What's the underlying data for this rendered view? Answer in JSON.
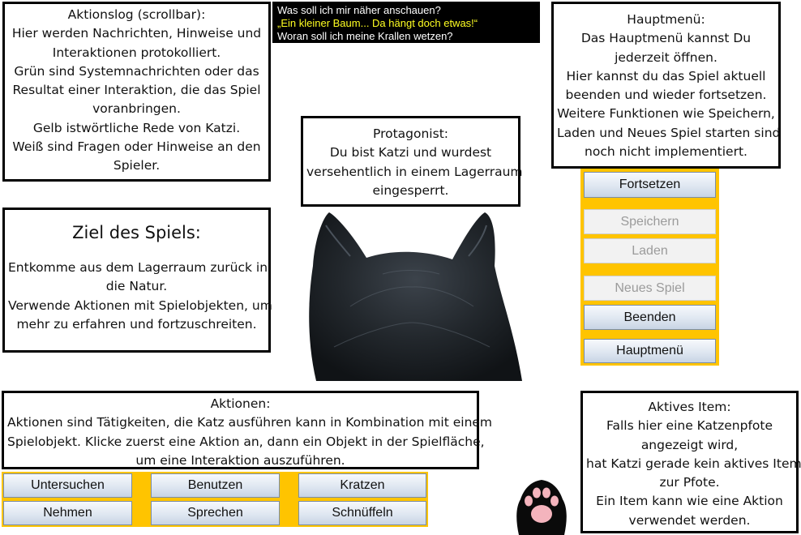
{
  "log": {
    "lines": [
      {
        "text": "Was soll ich mir näher anschauen?",
        "color": "#ffffff"
      },
      {
        "text": "„Ein kleiner Baum... Da hängt doch etwas!“",
        "color": "#ffff22"
      },
      {
        "text": "Woran soll ich meine Krallen wetzen?",
        "color": "#ffffff"
      }
    ]
  },
  "info_log": {
    "lines": [
      "Aktionslog (scrollbar):",
      "Hier werden Nachrichten, Hinweise und",
      "Interaktionen protokolliert.",
      "Grün sind Systemnachrichten oder das",
      "Resultat einer Interaktion, die das Spiel",
      "voranbringen.",
      "Gelb istwörtliche Rede von Katzi.",
      "Weiß sind Fragen oder Hinweise an den",
      "Spieler."
    ]
  },
  "info_goal": {
    "title": "Ziel des Spiels:",
    "lines": [
      "Entkomme aus dem Lagerraum zurück in",
      "die Natur.",
      "Verwende Aktionen mit Spielobjekten, um",
      "mehr zu erfahren und fortzuschreiten."
    ]
  },
  "info_protagonist": {
    "lines": [
      "Protagonist:",
      "Du bist Katzi und wurdest",
      "versehentlich in einem Lagerraum",
      "eingesperrt."
    ]
  },
  "info_menu": {
    "lines": [
      "Hauptmenü:",
      "Das Hauptmenü kannst Du",
      "jederzeit öffnen.",
      "Hier kannst du das Spiel aktuell",
      "beenden und wieder fortsetzen.",
      "Weitere Funktionen wie Speichern,",
      "Laden und Neues Spiel starten sind",
      "noch nicht implementiert."
    ]
  },
  "info_actions": {
    "lines": [
      "Aktionen:",
      "Aktionen sind Tätigkeiten, die Katz ausführen kann in Kombination mit einem",
      "Spielobjekt. Klicke zuerst eine Aktion an, dann ein Objekt in der Spielfläche,",
      "um eine Interaktion auszuführen."
    ]
  },
  "info_item": {
    "lines": [
      "Aktives Item:",
      "Falls hier eine Katzenpfote",
      "angezeigt wird,",
      "hat Katzi gerade kein aktives Item",
      "zur Pfote.",
      "Ein Item kann wie eine Aktion",
      "verwendet werden."
    ]
  },
  "menu": {
    "continue": "Fortsetzen",
    "save": "Speichern",
    "load": "Laden",
    "new_game": "Neues Spiel",
    "quit": "Beenden",
    "main_menu": "Hauptmenü"
  },
  "actions": {
    "examine": "Untersuchen",
    "use": "Benutzen",
    "scratch": "Kratzen",
    "take": "Nehmen",
    "talk": "Sprechen",
    "sniff": "Schnüffeln"
  },
  "colors": {
    "panel": "#ffc400",
    "log_bg": "#000000",
    "log_text": "#ffffff",
    "speech": "#ffff22"
  },
  "icons": {
    "protagonist": "cat-head-back-icon",
    "active_item": "cat-paw-icon"
  }
}
